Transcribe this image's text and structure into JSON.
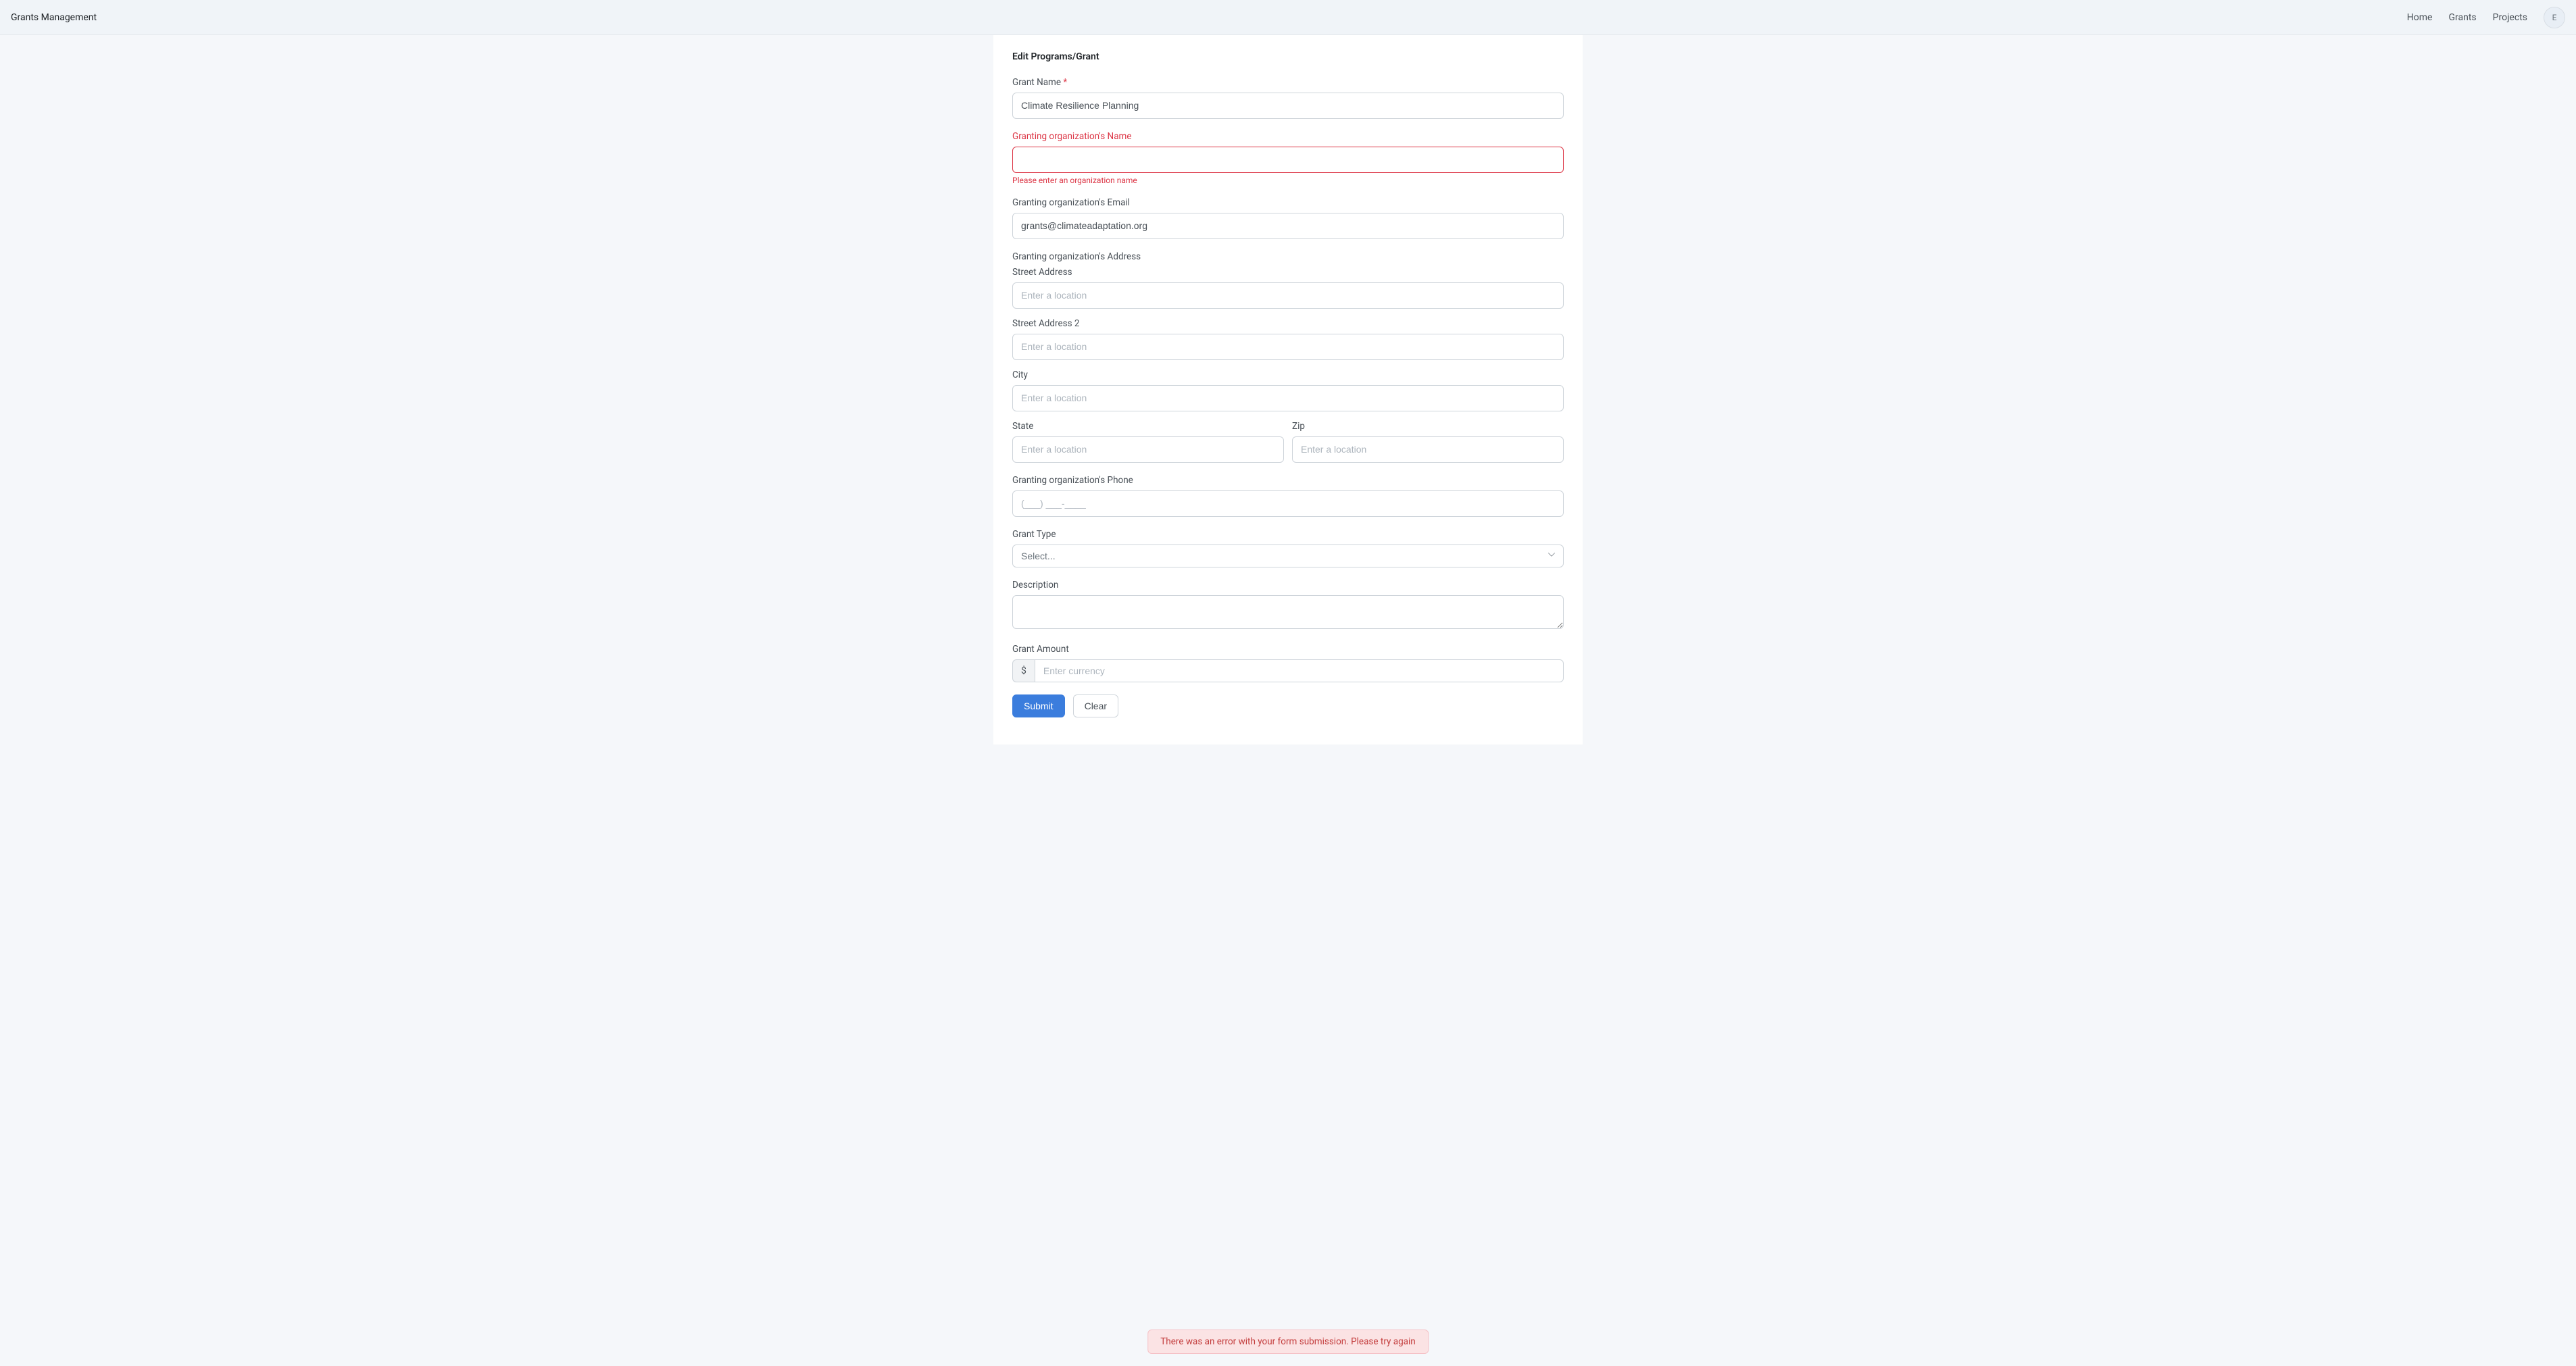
{
  "navbar": {
    "brand": "Grants Management",
    "links": {
      "home": "Home",
      "grants": "Grants",
      "projects": "Projects"
    },
    "avatar_initial": "E"
  },
  "form": {
    "title": "Edit Programs/Grant",
    "grant_name": {
      "label": "Grant Name",
      "required_mark": "*",
      "value": "Climate Resilience Planning"
    },
    "org_name": {
      "label": "Granting organization's Name",
      "error_msg": "Please enter an organization name"
    },
    "org_email": {
      "label": "Granting organization's Email",
      "value": "grants@climateadaptation.org"
    },
    "org_address": {
      "label": "Granting organization's Address",
      "street1_label": "Street Address",
      "street1_placeholder": "Enter a location",
      "street2_label": "Street Address 2",
      "street2_placeholder": "Enter a location",
      "city_label": "City",
      "city_placeholder": "Enter a location",
      "state_label": "State",
      "state_placeholder": "Enter a location",
      "zip_label": "Zip",
      "zip_placeholder": "Enter a location"
    },
    "org_phone": {
      "label": "Granting organization's Phone",
      "placeholder": "(___) ___-____"
    },
    "grant_type": {
      "label": "Grant Type",
      "placeholder": "Select..."
    },
    "description": {
      "label": "Description"
    },
    "grant_amount": {
      "label": "Grant Amount",
      "currency_symbol": "$",
      "placeholder": "Enter currency"
    },
    "buttons": {
      "submit": "Submit",
      "clear": "Clear"
    }
  },
  "toast": {
    "error_message": "There was an error with your form submission. Please try again"
  }
}
